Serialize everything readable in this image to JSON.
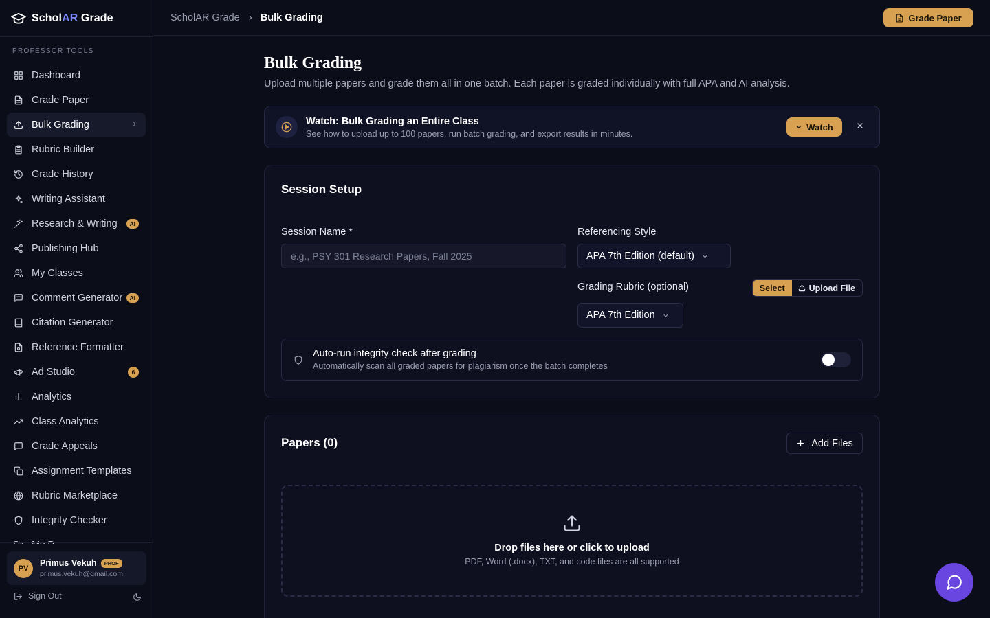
{
  "brand": {
    "prefix": "Schol",
    "accent": "AR",
    "suffix": " Grade"
  },
  "sidebar": {
    "section_label": "PROFESSOR TOOLS",
    "items": [
      {
        "label": "Dashboard",
        "icon": "grid-icon"
      },
      {
        "label": "Grade Paper",
        "icon": "file-icon"
      },
      {
        "label": "Bulk Grading",
        "icon": "upload-icon",
        "active": true
      },
      {
        "label": "Rubric Builder",
        "icon": "clipboard-icon"
      },
      {
        "label": "Grade History",
        "icon": "history-icon"
      },
      {
        "label": "Writing Assistant",
        "icon": "sparkles-icon"
      },
      {
        "label": "Research & Writing",
        "icon": "wand-icon",
        "badge": "AI"
      },
      {
        "label": "Publishing Hub",
        "icon": "share-icon"
      },
      {
        "label": "My Classes",
        "icon": "users-icon"
      },
      {
        "label": "Comment Generator",
        "icon": "message-icon",
        "badge": "AI"
      },
      {
        "label": "Citation Generator",
        "icon": "book-icon"
      },
      {
        "label": "Reference Formatter",
        "icon": "file-cog-icon"
      },
      {
        "label": "Ad Studio",
        "icon": "megaphone-icon",
        "count": "6"
      },
      {
        "label": "Analytics",
        "icon": "bar-chart-icon"
      },
      {
        "label": "Class Analytics",
        "icon": "trending-icon"
      },
      {
        "label": "Grade Appeals",
        "icon": "message-square-icon"
      },
      {
        "label": "Assignment Templates",
        "icon": "copy-icon"
      },
      {
        "label": "Rubric Marketplace",
        "icon": "globe-icon"
      },
      {
        "label": "Integrity Checker",
        "icon": "shield-icon"
      },
      {
        "label": "My P...",
        "icon": "folder-icon"
      }
    ]
  },
  "user": {
    "initials": "PV",
    "name": "Primus Vekuh",
    "role": "PROF",
    "email": "primus.vekuh@gmail.com"
  },
  "sign_out": "Sign Out",
  "topbar": {
    "crumb_root": "ScholAR Grade",
    "crumb_current": "Bulk Grading",
    "grade_button": "Grade Paper"
  },
  "page": {
    "title": "Bulk Grading",
    "subtitle": "Upload multiple papers and grade them all in one batch. Each paper is graded individually with full APA and AI analysis."
  },
  "watch": {
    "title": "Watch: Bulk Grading an Entire Class",
    "subtitle": "See how to upload up to 100 papers, run batch grading, and export results in minutes.",
    "button": "Watch"
  },
  "setup": {
    "title": "Session Setup",
    "session_name_label": "Session Name *",
    "session_name_placeholder": "e.g., PSY 301 Research Papers, Fall 2025",
    "ref_style_label": "Referencing Style",
    "ref_style_value": "APA 7th Edition (default)",
    "rubric_label": "Grading Rubric (optional)",
    "rubric_select": "Select",
    "rubric_upload": "Upload File",
    "rubric_value": "APA 7th Edition",
    "integrity_title": "Auto-run integrity check after grading",
    "integrity_sub": "Automatically scan all graded papers for plagiarism once the batch completes",
    "integrity_enabled": false
  },
  "papers": {
    "title": "Papers (0)",
    "add_button": "Add Files",
    "drop_title": "Drop files here or click to upload",
    "drop_sub": "PDF, Word (.docx), TXT, and code files are all supported"
  },
  "colors": {
    "accent": "#d8a152",
    "brand": "#7b86ff",
    "fab": "#6a46e0",
    "background": "#0b0d19"
  }
}
